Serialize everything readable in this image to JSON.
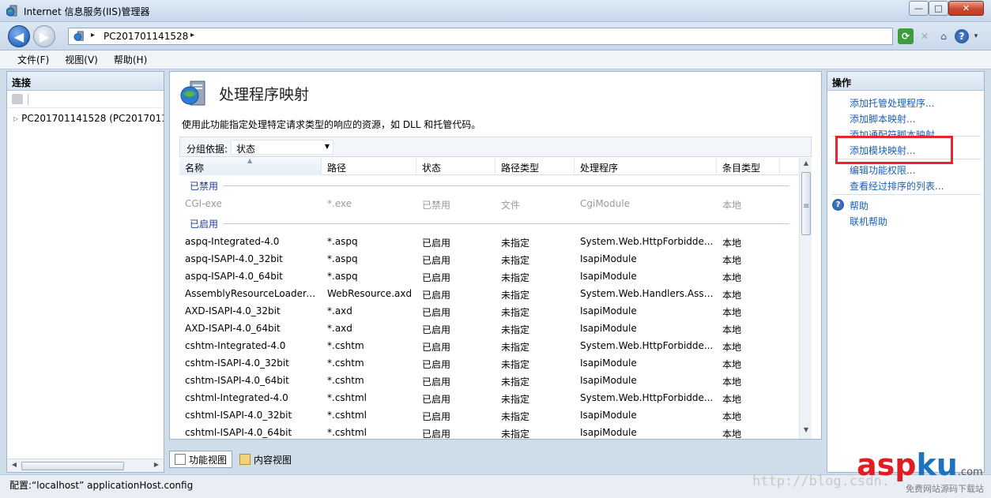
{
  "window": {
    "title": "Internet 信息服务(IIS)管理器",
    "min_glyph": "—",
    "max_glyph": "□",
    "close_glyph": "✕"
  },
  "nav": {
    "back_glyph": "◀",
    "forward_glyph": "▶",
    "breadcrumb_sep": "▸",
    "address": "PC201701141528"
  },
  "menu": [
    "文件(F)",
    "视图(V)",
    "帮助(H)"
  ],
  "left_panel": {
    "header": "连接",
    "tree_node": "PC201701141528 (PC201701141528\\Administrator)"
  },
  "center": {
    "title": "处理程序映射",
    "description": "使用此功能指定处理特定请求类型的响应的资源，如 DLL 和托管代码。",
    "group_label": "分组依据:",
    "group_value": "状态",
    "columns": [
      "名称",
      "路径",
      "状态",
      "路径类型",
      "处理程序",
      "条目类型"
    ],
    "group_disabled": "已禁用",
    "group_enabled": "已启用",
    "disabled_rows": [
      [
        "CGI-exe",
        "*.exe",
        "已禁用",
        "文件",
        "CgiModule",
        "本地"
      ]
    ],
    "rows": [
      [
        "aspq-Integrated-4.0",
        "*.aspq",
        "已启用",
        "未指定",
        "System.Web.HttpForbidde...",
        "本地"
      ],
      [
        "aspq-ISAPI-4.0_32bit",
        "*.aspq",
        "已启用",
        "未指定",
        "IsapiModule",
        "本地"
      ],
      [
        "aspq-ISAPI-4.0_64bit",
        "*.aspq",
        "已启用",
        "未指定",
        "IsapiModule",
        "本地"
      ],
      [
        "AssemblyResourceLoader-I...",
        "WebResource.axd",
        "已启用",
        "未指定",
        "System.Web.Handlers.Asse...",
        "本地"
      ],
      [
        "AXD-ISAPI-4.0_32bit",
        "*.axd",
        "已启用",
        "未指定",
        "IsapiModule",
        "本地"
      ],
      [
        "AXD-ISAPI-4.0_64bit",
        "*.axd",
        "已启用",
        "未指定",
        "IsapiModule",
        "本地"
      ],
      [
        "cshtm-Integrated-4.0",
        "*.cshtm",
        "已启用",
        "未指定",
        "System.Web.HttpForbidde...",
        "本地"
      ],
      [
        "cshtm-ISAPI-4.0_32bit",
        "*.cshtm",
        "已启用",
        "未指定",
        "IsapiModule",
        "本地"
      ],
      [
        "cshtm-ISAPI-4.0_64bit",
        "*.cshtm",
        "已启用",
        "未指定",
        "IsapiModule",
        "本地"
      ],
      [
        "cshtml-Integrated-4.0",
        "*.cshtml",
        "已启用",
        "未指定",
        "System.Web.HttpForbidde...",
        "本地"
      ],
      [
        "cshtml-ISAPI-4.0_32bit",
        "*.cshtml",
        "已启用",
        "未指定",
        "IsapiModule",
        "本地"
      ],
      [
        "cshtml-ISAPI-4.0_64bit",
        "*.cshtml",
        "已启用",
        "未指定",
        "IsapiModule",
        "本地"
      ]
    ],
    "view_tabs": [
      "功能视图",
      "内容视图"
    ]
  },
  "right_panel": {
    "header": "操作",
    "actions": [
      "添加托管处理程序...",
      "添加脚本映射...",
      "添加通配符脚本映射...",
      "添加模块映射...",
      "编辑功能权限...",
      "查看经过排序的列表..."
    ],
    "help": "帮助",
    "online_help": "联机帮助"
  },
  "status": {
    "text": "配置:“localhost” applicationHost.config"
  },
  "watermark": {
    "url": "http://blog.csdn.",
    "logo_asp": "asp",
    "logo_ku": "ku",
    "logo_com": ".com",
    "logo_sub": "免费网站源码下载站"
  },
  "colors": {
    "link": "#1b5fb4",
    "group_text": "#1e3f8f",
    "highlight": "#e8252e"
  }
}
